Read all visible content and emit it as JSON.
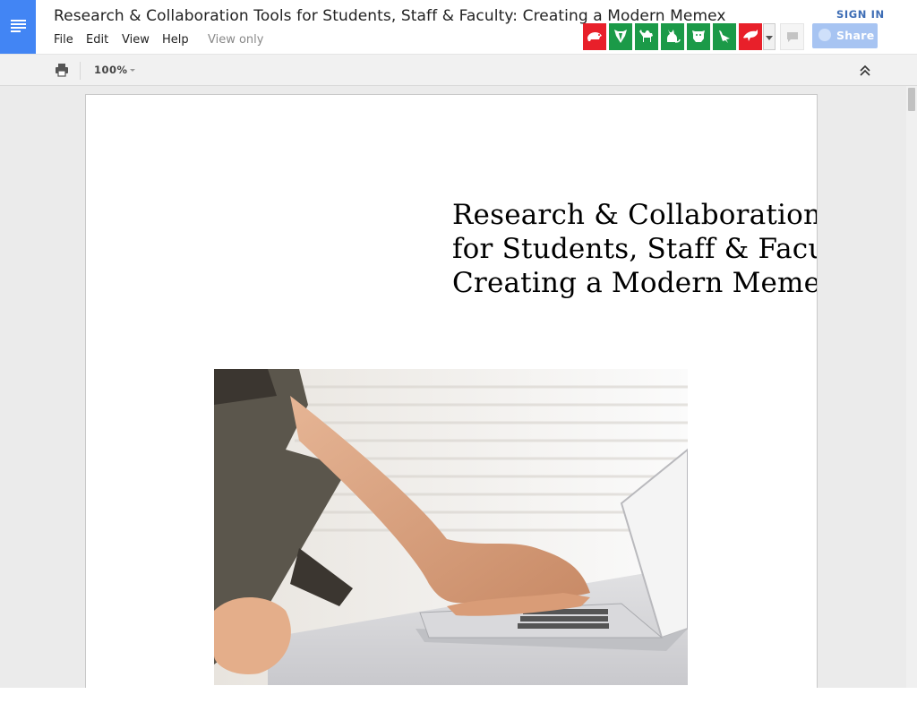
{
  "header": {
    "title": "Research & Collaboration Tools for Students, Staff & Faculty: Creating a Modern Memex",
    "sign_in_label": "SIGN IN",
    "share_label": "Share",
    "view_only_label": "View only"
  },
  "menu": {
    "file": "File",
    "edit": "Edit",
    "view": "View",
    "help": "Help"
  },
  "toolbar": {
    "zoom_value": "100%"
  },
  "extensions": [
    {
      "icon": "rodent-icon",
      "color": "#e8202a"
    },
    {
      "icon": "badger-icon",
      "color": "#1b9a48"
    },
    {
      "icon": "camel-icon",
      "color": "#1b9a48"
    },
    {
      "icon": "cat-icon",
      "color": "#1b9a48"
    },
    {
      "icon": "cow-icon",
      "color": "#1b9a48"
    },
    {
      "icon": "bird-icon",
      "color": "#1b9a48"
    },
    {
      "icon": "dolphin-icon",
      "color": "#e8202a"
    }
  ],
  "document": {
    "heading_lines": [
      "Research & Collaboration Tools",
      "for Students, Staff & Faculty:",
      "Creating a Modern Memex"
    ]
  },
  "colors": {
    "brand_blue": "#4285f4",
    "share_blue": "#a7c4f2",
    "sign_in_blue": "#3d6db5",
    "extension_red": "#e8202a",
    "extension_green": "#1b9a48"
  }
}
